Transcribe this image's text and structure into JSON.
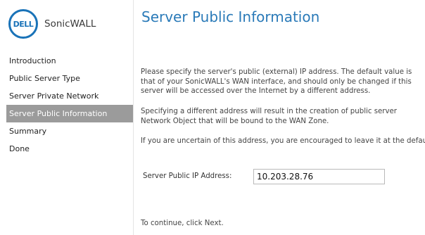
{
  "brand": {
    "logo_text": "DELL",
    "product": "SonicWALL",
    "accent_color": "#1a73b8"
  },
  "sidebar": {
    "items": [
      {
        "label": "Introduction",
        "active": false
      },
      {
        "label": "Public Server Type",
        "active": false
      },
      {
        "label": "Server Private Network",
        "active": false
      },
      {
        "label": "Server Public Information",
        "active": true
      },
      {
        "label": "Summary",
        "active": false
      },
      {
        "label": "Done",
        "active": false
      }
    ]
  },
  "main": {
    "title": "Server Public Information",
    "paragraphs": [
      "Please specify the server's public (external) IP address. The default value is that of your SonicWALL's WAN interface, and should only be changed if this server will be accessed over the Internet by a different address.",
      "Specifying a different address will result in the creation of public server Network Object that will be bound to the WAN Zone.",
      "If you are uncertain of this address, you are encouraged to leave it at the default."
    ],
    "ip_label": "Server Public IP Address:",
    "ip_value": "10.203.28.76",
    "footer": "To continue, click Next."
  }
}
